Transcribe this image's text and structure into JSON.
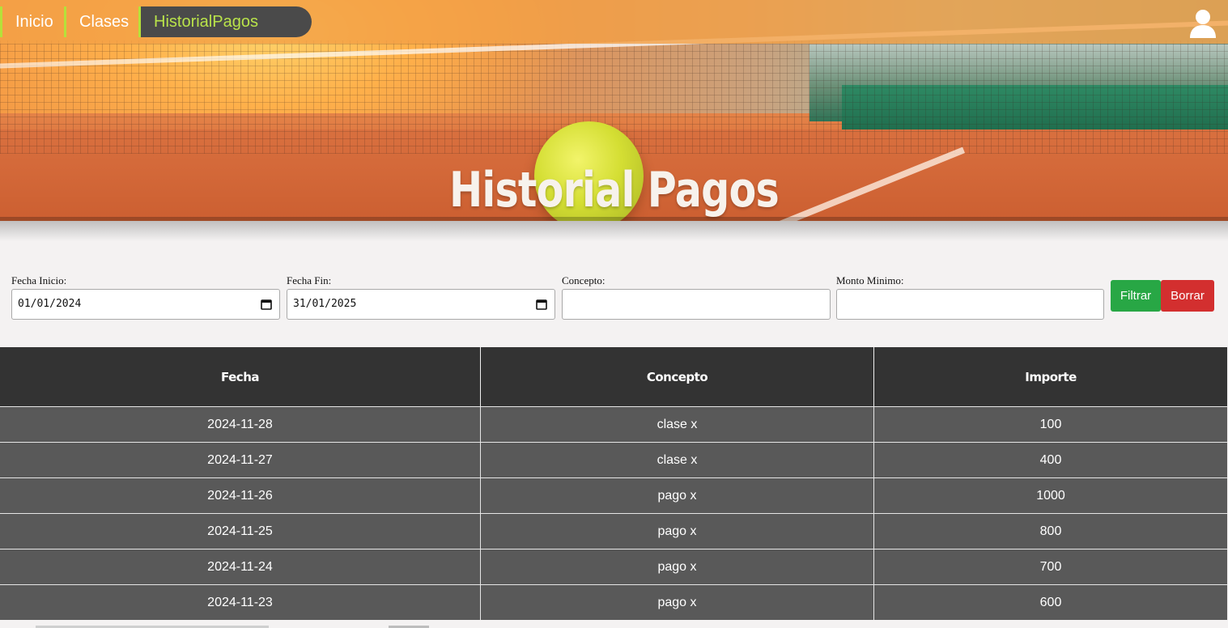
{
  "nav": {
    "items": [
      {
        "label": "Inicio"
      },
      {
        "label": "Clases"
      },
      {
        "label": "HistorialPagos"
      }
    ]
  },
  "hero": {
    "title": "Historial Pagos"
  },
  "filters": {
    "start_label": "Fecha Inicio:",
    "start_value": "01/01/2024",
    "end_label": "Fecha Fin:",
    "end_value": "31/01/2025",
    "concept_label": "Concepto:",
    "concept_value": "",
    "amount_label": "Monto Minimo:",
    "amount_value": "",
    "filter_button": "Filtrar",
    "clear_button": "Borrar"
  },
  "table": {
    "headers": [
      "Fecha",
      "Concepto",
      "Importe"
    ],
    "rows": [
      [
        "2024-11-28",
        "clase x",
        "100"
      ],
      [
        "2024-11-27",
        "clase x",
        "400"
      ],
      [
        "2024-11-26",
        "pago x",
        "1000"
      ],
      [
        "2024-11-25",
        "pago x",
        "800"
      ],
      [
        "2024-11-24",
        "pago x",
        "700"
      ],
      [
        "2024-11-23",
        "pago x",
        "600"
      ]
    ]
  },
  "colors": {
    "accent": "#b9e34a",
    "nav_bg": "#f2a046",
    "table_header": "#333333",
    "table_row": "#595959",
    "filter_button": "#28a745",
    "clear_button": "#d32f2f"
  },
  "icons": {
    "user": "user-icon",
    "calendar": "calendar-icon"
  }
}
